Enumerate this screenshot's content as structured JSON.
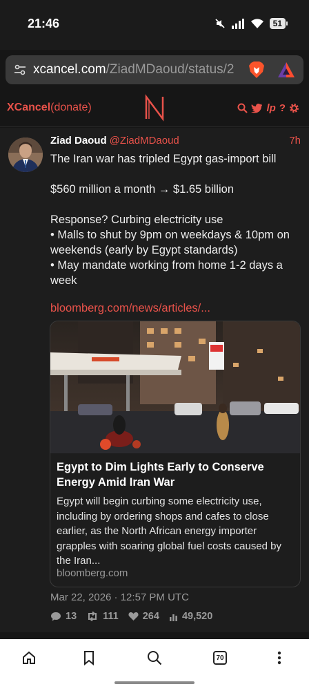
{
  "status_bar": {
    "time": "21:46",
    "battery": "51",
    "icons": [
      "mute-icon",
      "signal-icon",
      "wifi-icon",
      "battery-icon"
    ]
  },
  "browser": {
    "url_host": "xcancel.com",
    "url_path": "/ZiadMDaoud/status/2",
    "icons": [
      "tune-icon",
      "brave-lion-icon",
      "brave-rewards-icon"
    ]
  },
  "site": {
    "brand_name": "XCancel",
    "brand_suffix": "(donate)",
    "logo": "N",
    "accent_color": "#e8524a",
    "header_icons": [
      "search-icon",
      "twitter-bird-icon",
      "liberapay-icon",
      "help-icon",
      "settings-icon"
    ]
  },
  "tweet": {
    "author_name": "Ziad Daoud",
    "author_handle": "@ZiadMDaoud",
    "time_ago": "7h",
    "lines": [
      "The Iran war has tripled Egypt gas-import bill",
      "",
      "$560 million a month → $1.65 billion",
      "",
      "Response? Curbing electricity use",
      "• Malls to shut by 9pm on weekdays & 10pm on weekends (early by Egypt standards)",
      "• May mandate working from home 1-2 days a week"
    ],
    "link_text": "bloomberg.com/news/articles/...",
    "card": {
      "title": "Egypt to Dim Lights Early to Conserve Energy Amid Iran War",
      "description": "Egypt will begin curbing some electricity use, including by ordering shops and cafes to close earlier, as the North African energy importer grapples with soaring global fuel costs caused by the Iran...",
      "domain": "bloomberg.com"
    },
    "date": "Mar 22, 2026 · 12:57 PM UTC",
    "stats": {
      "replies": "13",
      "retweets": "111",
      "likes": "264",
      "views": "49,520"
    }
  },
  "bottom_nav": {
    "tab_count": "70",
    "items": [
      "home-icon",
      "bookmark-icon",
      "search-icon",
      "tabs-icon",
      "more-icon"
    ]
  }
}
